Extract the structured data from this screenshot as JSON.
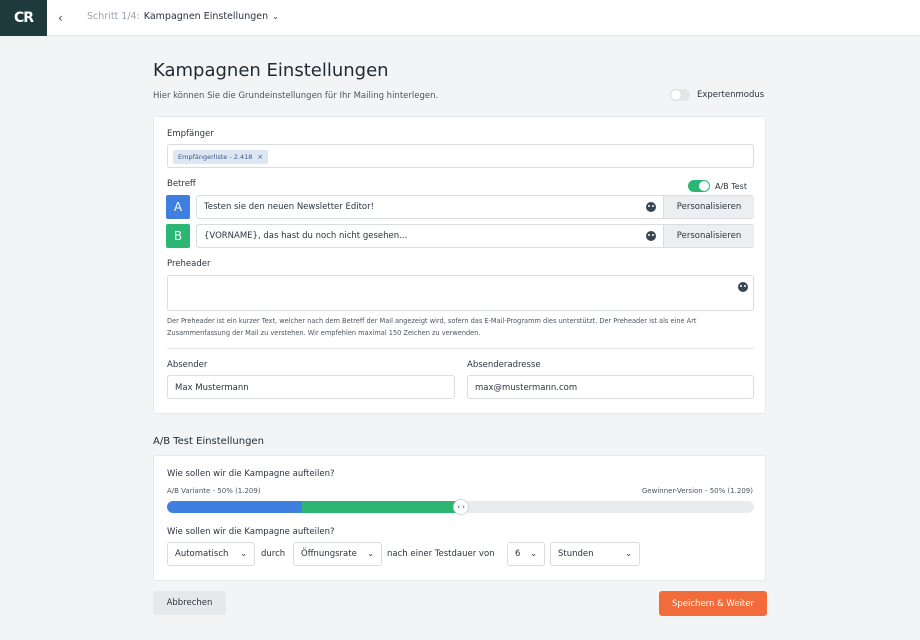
{
  "topbar": {
    "logo_text": "CR",
    "back_icon": "chevron-left-icon",
    "step_label": "Schritt 1/4:",
    "step_title": "Kampagnen Einstellungen",
    "dropdown_icon": "chevron-down-icon"
  },
  "header": {
    "title": "Kampagnen Einstellungen",
    "subtitle": "Hier können Sie die Grundeinstellungen für Ihr Mailing hinterlegen.",
    "expert_label": "Expertenmodus",
    "expert_enabled": false
  },
  "recipients": {
    "label": "Empfänger",
    "chip_label": "Empfängerliste - 2.418",
    "chip_remove": "×"
  },
  "subject": {
    "label": "Betreff",
    "ab_label": "A/B Test",
    "ab_enabled": true,
    "variants": [
      {
        "letter": "A",
        "text": "Testen sie den neuen Newsletter Editor!",
        "button": "Personalisieren"
      },
      {
        "letter": "B",
        "text": "{VORNAME}, das hast du noch nicht gesehen...",
        "button": "Personalisieren"
      }
    ]
  },
  "preheader": {
    "label": "Preheader",
    "value": "",
    "hint": "Der Preheader ist ein kurzer Text, welcher nach dem Betreff der Mail angezeigt wird, sofern das E-Mail-Programm dies unterstützt. Der Preheader ist als eine Art Zusammenfassung der Mail zu verstehen. Wir empfehlen maximal 150 Zeichen zu verwenden."
  },
  "sender": {
    "name_label": "Absender",
    "name_value": "Max Mustermann",
    "address_label": "Absenderadresse",
    "address_value": "max@mustermann.com"
  },
  "ab_settings": {
    "title": "A/B Test Einstellungen",
    "question1": "Wie sollen wir die Kampagne aufteilen?",
    "left_caption": "A/B Variante - 50% (1.209)",
    "right_caption": "Gewinner-Version - 50% (1.209)",
    "split_fraction": 0.5,
    "knob_symbol": "‹ ›",
    "question2": "Wie sollen wir die Kampagne aufteilen?",
    "mode_value": "Automatisch",
    "by_text": "durch",
    "metric_value": "Öffnungsrate",
    "after_text": "nach einer Testdauer von",
    "duration_value": "6",
    "unit_value": "Stunden"
  },
  "footer": {
    "cancel": "Abbrechen",
    "save": "Speichern & Weiter"
  },
  "colors": {
    "accent_blue": "#3f7fe0",
    "accent_green": "#2bb673",
    "primary_orange": "#f26b3a",
    "logo_bg": "#1f3a3c"
  }
}
